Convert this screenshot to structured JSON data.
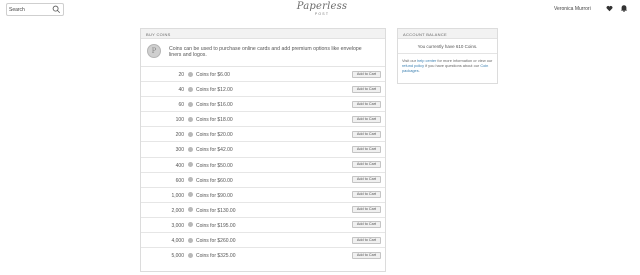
{
  "header": {
    "search_placeholder": "Search",
    "logo_script": "Paperless",
    "logo_sub": "POST",
    "user_name": "Veronica Murrori"
  },
  "buy_coins": {
    "heading": "BUY COINS",
    "coin_symbol": "P",
    "intro": "Coins can be used to purchase online cards and add premium options like envelope liners and logos.",
    "add_label": "Add to Cart",
    "packages": [
      {
        "coins": "20",
        "price": "Coins for $6.00"
      },
      {
        "coins": "40",
        "price": "Coins for $12.00"
      },
      {
        "coins": "60",
        "price": "Coins for $16.00"
      },
      {
        "coins": "100",
        "price": "Coins for $18.00"
      },
      {
        "coins": "200",
        "price": "Coins for $20.00"
      },
      {
        "coins": "300",
        "price": "Coins for $42.00"
      },
      {
        "coins": "400",
        "price": "Coins for $50.00"
      },
      {
        "coins": "600",
        "price": "Coins for $60.00"
      },
      {
        "coins": "1,000",
        "price": "Coins for $90.00"
      },
      {
        "coins": "2,000",
        "price": "Coins for $130.00"
      },
      {
        "coins": "3,000",
        "price": "Coins for $195.00"
      },
      {
        "coins": "4,000",
        "price": "Coins for $260.00"
      },
      {
        "coins": "5,000",
        "price": "Coins for $325.00"
      }
    ]
  },
  "account_balance": {
    "heading": "ACCOUNT BALANCE",
    "balance_text": "You currently have 610 Coins.",
    "help_1": "Visit our ",
    "help_link_1": "help center",
    "help_2": " for more information or view our ",
    "help_link_2": "refund policy",
    "help_3": " if you have questions about our ",
    "help_link_3": "Coin packages",
    "help_4": "."
  },
  "colors": {
    "link": "#3a7fb0",
    "panel_header_bg": "#f2f2f2"
  },
  "icons": [
    "search-icon",
    "heart-icon",
    "bell-icon"
  ]
}
